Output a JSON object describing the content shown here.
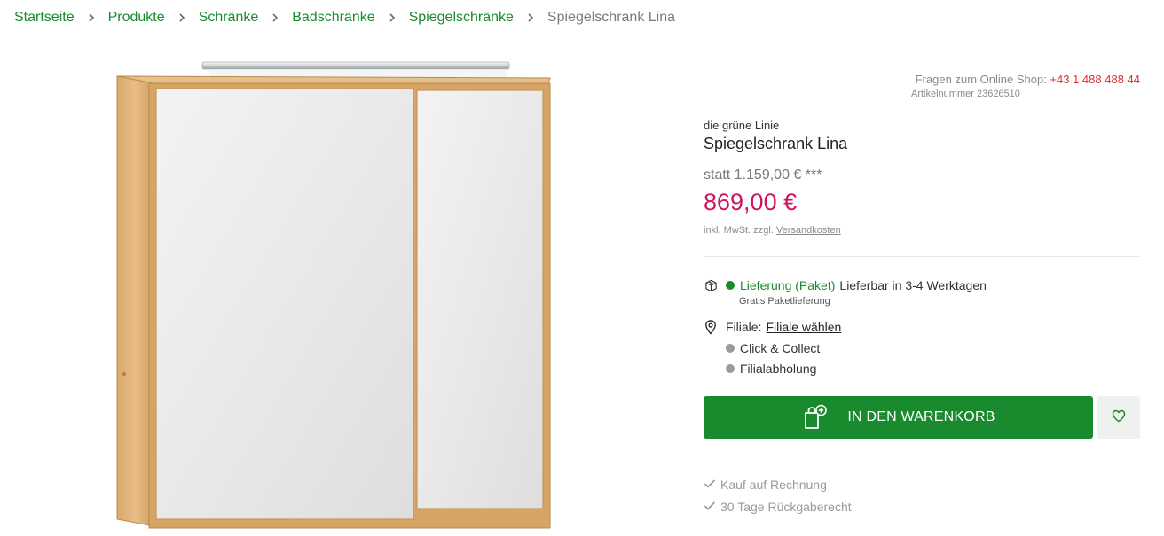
{
  "breadcrumb": {
    "items": [
      "Startseite",
      "Produkte",
      "Schränke",
      "Badschränke",
      "Spiegelschränke"
    ],
    "current": "Spiegelschrank Lina"
  },
  "contact": {
    "label": "Fragen zum Online Shop:",
    "phone": "+43 1 488 488 44",
    "article_number": "Artikelnummer 23626510"
  },
  "product": {
    "brand": "die grüne Linie",
    "title": "Spiegelschrank Lina",
    "old_price": "statt 1.159,00 € ***",
    "price": "869,00 €",
    "tax_prefix": "inkl. MwSt. zzgl.",
    "tax_link": "Versandkosten"
  },
  "delivery": {
    "label": "Lieferung (Paket)",
    "availability": "Lieferbar in 3-4 Werktagen",
    "note": "Gratis Paketlieferung"
  },
  "store": {
    "label": "Filiale:",
    "link": "Filiale wählen",
    "options": [
      "Click & Collect",
      "Filialabholung"
    ]
  },
  "actions": {
    "cart_label": "IN DEN WARENKORB"
  },
  "benefits": [
    "Kauf auf Rechnung",
    "30 Tage Rückgaberecht"
  ],
  "colors": {
    "brand_green": "#1a8a2e",
    "price_red": "#d0145f",
    "phone_red": "#e03030",
    "status_grey": "#9a9a9a"
  },
  "icons": {
    "breadcrumb_separator": "chevron-right-icon",
    "delivery": "package-icon",
    "store": "location-pin-icon",
    "cart": "shopping-bag-plus-icon",
    "wishlist": "heart-icon",
    "benefit": "check-icon"
  }
}
